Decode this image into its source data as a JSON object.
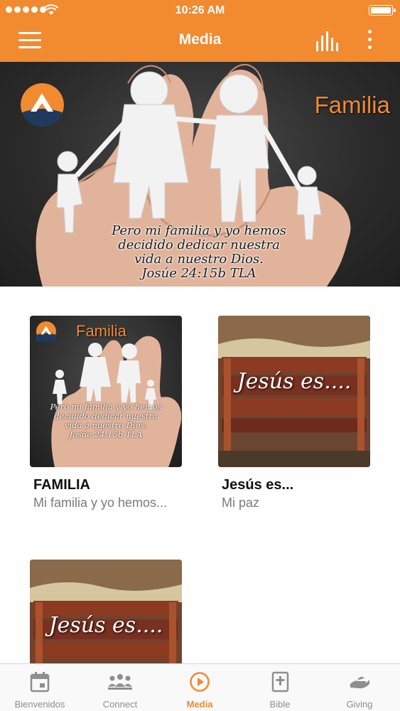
{
  "status_bar": {
    "time": "10:26 AM"
  },
  "header": {
    "title": "Media"
  },
  "hero": {
    "brand": "Familia",
    "verse": "Pero mi familia y yo hemos\ndecidido dedicar nuestra\nvida a nuestro Dios.\nJosúe 24:15b TLA"
  },
  "items": [
    {
      "title": "FAMILIA",
      "subtitle": "Mi familia y yo hemos...",
      "thumb_brand": "Familia",
      "thumb_verse": "Pero mi familia y yo hemos\ndecidido dedicar nuestra\nvida a nuestro Dios.\nJosúe 24:15b TLA"
    },
    {
      "title": "Jesús es...",
      "subtitle": "Mi paz",
      "thumb_text": "Jesús es...."
    },
    {
      "thumb_text": "Jesús es...."
    }
  ],
  "tabs": [
    {
      "label": "Bienvenidos",
      "icon": "calendar-icon"
    },
    {
      "label": "Connect",
      "icon": "group-icon"
    },
    {
      "label": "Media",
      "icon": "play-circle-icon",
      "active": true
    },
    {
      "label": "Bible",
      "icon": "bible-icon"
    },
    {
      "label": "Giving",
      "icon": "giving-hand-icon"
    }
  ],
  "colors": {
    "accent": "#f28a30",
    "tab_inactive": "#8e8e8e",
    "background": "#ffffff"
  }
}
